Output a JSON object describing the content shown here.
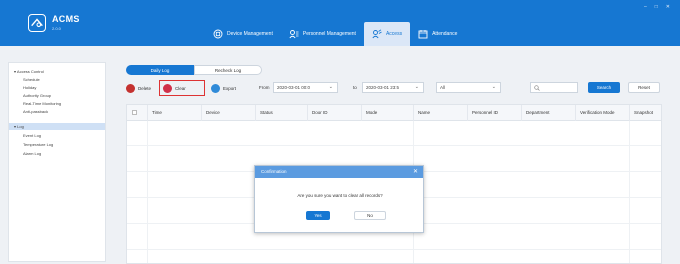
{
  "app": {
    "title": "ACMS",
    "version": "2.0.0"
  },
  "window_controls": [
    "–",
    "□",
    "✕"
  ],
  "nav": {
    "items": [
      {
        "label": "Device Management",
        "icon": "device-icon"
      },
      {
        "label": "Personnel Management",
        "icon": "personnel-icon"
      },
      {
        "label": "Access",
        "icon": "access-icon",
        "active": true
      },
      {
        "label": "Attendance",
        "icon": "attendance-icon"
      }
    ]
  },
  "sidebar": {
    "items": [
      {
        "label": "Access Control",
        "group": true
      },
      {
        "label": "Schedule"
      },
      {
        "label": "Holiday"
      },
      {
        "label": "Authority Group"
      },
      {
        "label": "Real-Time Monitoring"
      },
      {
        "label": "Anti-passback"
      },
      {
        "label": "Log",
        "group": true,
        "active": true
      },
      {
        "label": "Event Log"
      },
      {
        "label": "Temperature Log"
      },
      {
        "label": "Alarm Log"
      }
    ]
  },
  "tabs": [
    "Daily Log",
    "Recheck Log"
  ],
  "toolbar": {
    "delete_label": "Delete",
    "clear_label": "Clear",
    "export_label": "Export",
    "from_label": "From",
    "from_value": "2020-03-01 00:0",
    "to_label": "to",
    "to_value": "2020-03-01 23:5",
    "filter_value": "All",
    "search_label": "Search",
    "reset_label": "Reset"
  },
  "table": {
    "columns": [
      "Time",
      "Device",
      "Status",
      "Door ID",
      "Mode",
      "Name",
      "Personnel ID",
      "Department",
      "Verification Mode",
      "Snapshot"
    ]
  },
  "dialog": {
    "title": "Confirmation",
    "message": "Are you sure you want to clear all records?",
    "yes_label": "Yes",
    "no_label": "No"
  },
  "colors": {
    "primary": "#1677d2",
    "header": "#1677d2",
    "highlight": "#dd3333",
    "dialog_header": "#5b9be0"
  }
}
